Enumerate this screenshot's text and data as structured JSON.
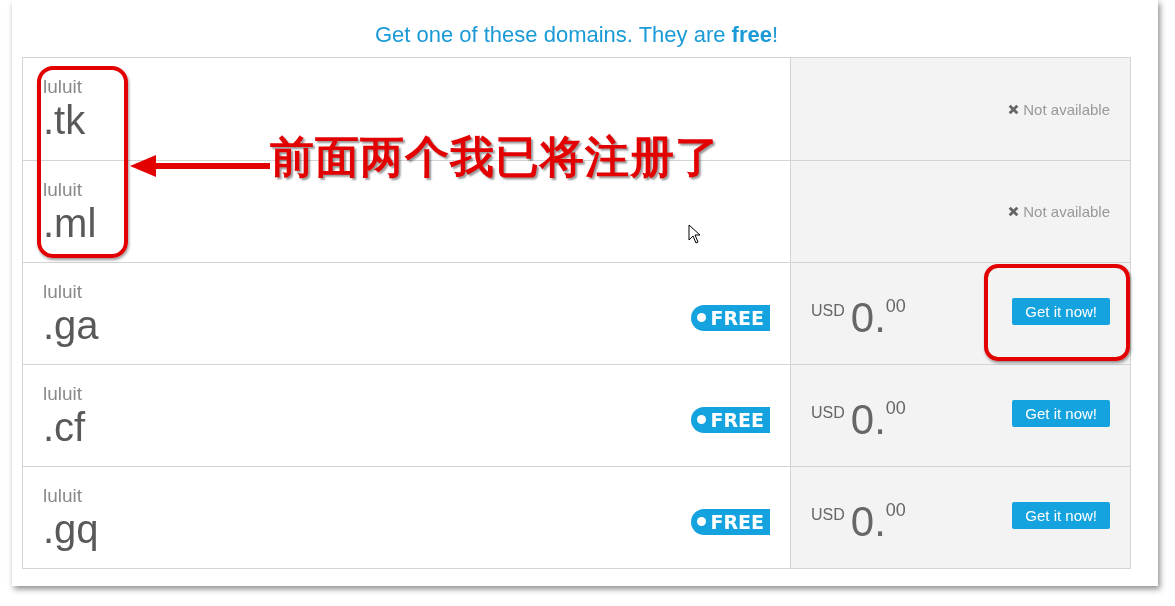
{
  "heading": {
    "text": "Get one of these domains. They are **free**!"
  },
  "rows": [
    {
      "kind": "unavailable",
      "name": "luluit",
      "tld": ".tk",
      "status": "Not available"
    },
    {
      "kind": "unavailable",
      "name": "luluit",
      "tld": ".ml",
      "status": "Not available"
    },
    {
      "kind": "free",
      "name": "luluit",
      "tld": ".ga",
      "badge": "FREE",
      "currency": "USD",
      "whole": "0.",
      "cents": "00",
      "button": "Get it now!",
      "circled": true
    },
    {
      "kind": "free",
      "name": "luluit",
      "tld": ".cf",
      "badge": "FREE",
      "currency": "USD",
      "whole": "0.",
      "cents": "00",
      "button": "Get it now!",
      "circled": false
    },
    {
      "kind": "free",
      "name": "luluit",
      "tld": ".gq",
      "badge": "FREE",
      "currency": "USD",
      "whole": "0.",
      "cents": "00",
      "button": "Get it now!",
      "circled": false
    }
  ],
  "annotation": {
    "note": "前面两个我已将注册了"
  }
}
